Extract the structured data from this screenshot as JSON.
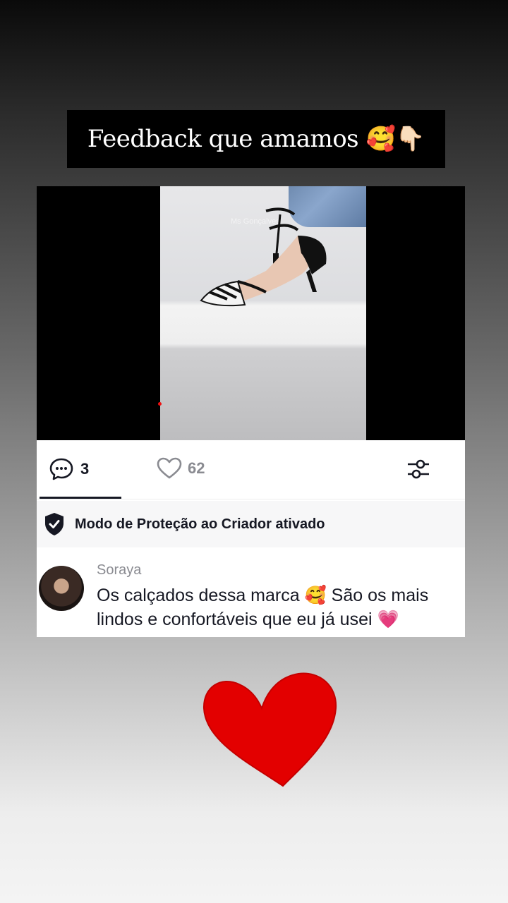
{
  "banner": {
    "title": "Feedback que amamos 🥰👇🏻"
  },
  "video": {
    "watermark": "Ms Gonçalves"
  },
  "actions": {
    "comment_count": "3",
    "like_count": "62"
  },
  "protection": {
    "label": "Modo de Proteção ao Criador ativado"
  },
  "comment": {
    "username": "Soraya",
    "text": "Os calçados dessa marca 🥰 São os mais lindos e confortáveis que eu já usei 💗"
  },
  "colors": {
    "heart_red": "#e30000",
    "text_primary": "#161823",
    "text_secondary": "#8a8b91"
  },
  "icons": [
    "comment-icon",
    "heart-outline-icon",
    "filter-sliders-icon",
    "shield-check-icon",
    "big-heart-icon"
  ]
}
